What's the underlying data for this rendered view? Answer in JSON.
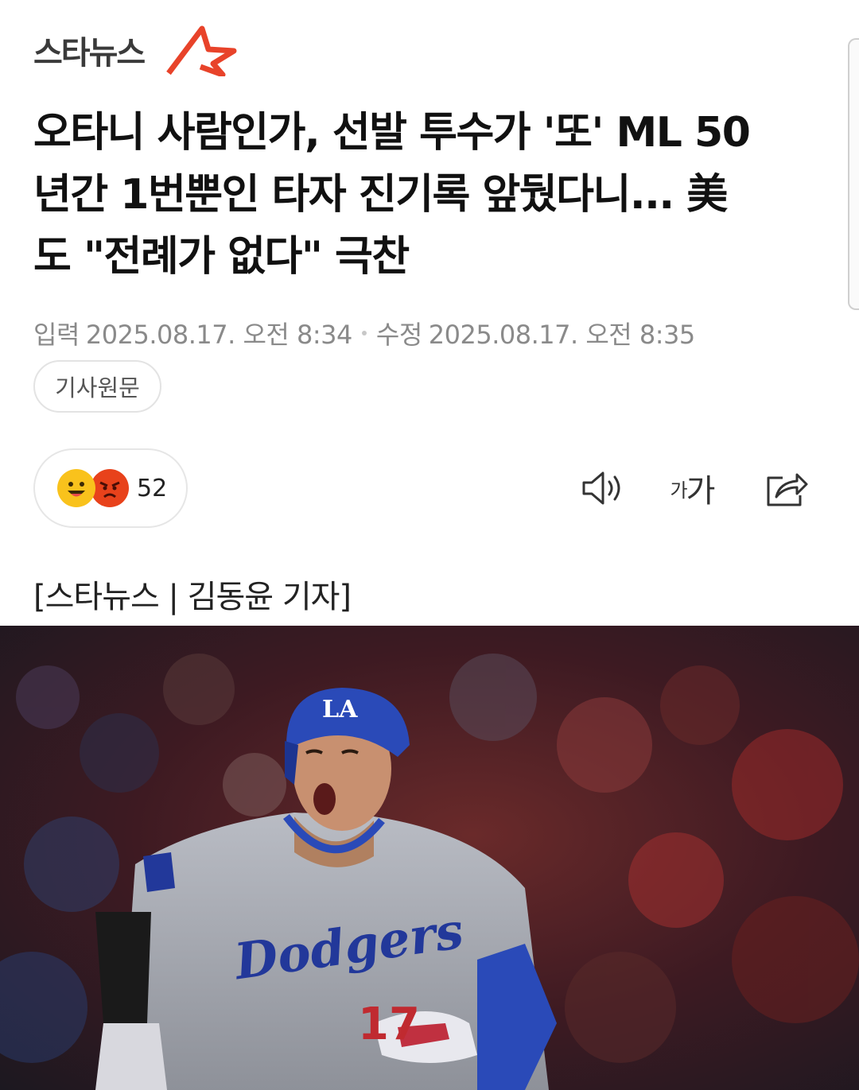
{
  "brand": {
    "name": "스타뉴스",
    "accent_color": "#e8432a"
  },
  "article": {
    "headline_lines": [
      "오타니 사람인가, 선발 투수가 '또' ML 50",
      "년간 1번뿐인 타자 진기록 앞뒀다니... 美",
      "도 \"전례가 없다\" 극찬"
    ],
    "input_label": "입력",
    "input_time": "2025.08.17. 오전 8:34",
    "edit_label": "수정",
    "edit_time": "2025.08.17. 오전 8:35",
    "original_button": "기사원문",
    "reaction_count": "52",
    "byline": "[스타뉴스 | 김동윤 기자]"
  },
  "toolbar": {
    "font_small": "가",
    "font_large": "가",
    "icons": [
      "speaker-icon",
      "font-size-icon",
      "share-icon"
    ]
  },
  "photo": {
    "jersey_text": "Dodgers",
    "helmet_text": "LA",
    "number_text": "17"
  }
}
